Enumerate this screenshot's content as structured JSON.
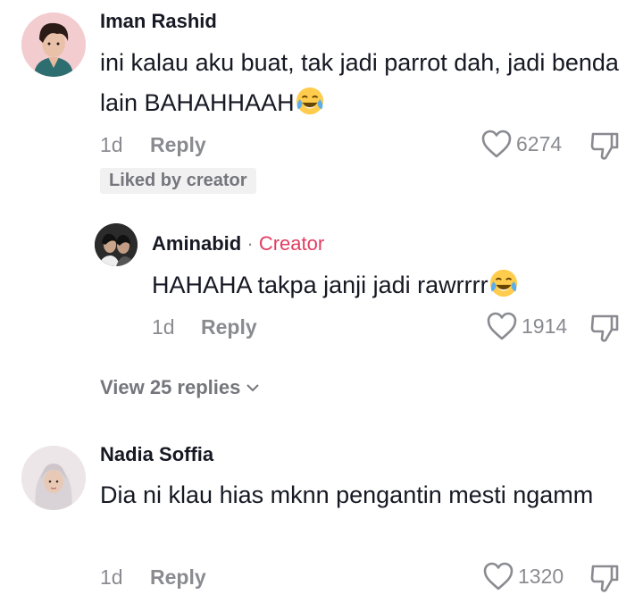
{
  "comments": [
    {
      "username": "Iman Rashid",
      "text": "ini kalau aku buat, tak jadi parrot dah, jadi benda lain BAHAHHAAH",
      "emoji": "face-with-tears-of-joy",
      "time": "1d",
      "reply_label": "Reply",
      "likes": "6274",
      "badge": "Liked by creator",
      "reply": {
        "username": "Aminabid",
        "separator": "·",
        "creator_label": "Creator",
        "text": "HAHAHA takpa janji jadi rawrrrr",
        "emoji": "face-with-tears-of-joy",
        "time": "1d",
        "reply_label": "Reply",
        "likes": "1914"
      },
      "view_replies": "View 25 replies"
    },
    {
      "username": "Nadia Soffia",
      "text": "Dia ni klau hias mknn pengantin mesti ngamm",
      "time": "1d",
      "reply_label": "Reply",
      "likes": "1320"
    }
  ],
  "icons": {
    "like": "heart-outline-icon",
    "dislike": "thumbs-down-icon",
    "expand": "chevron-down-icon"
  },
  "colors": {
    "creator": "#e13e62",
    "muted": "#8a8b91",
    "text": "#161823"
  }
}
